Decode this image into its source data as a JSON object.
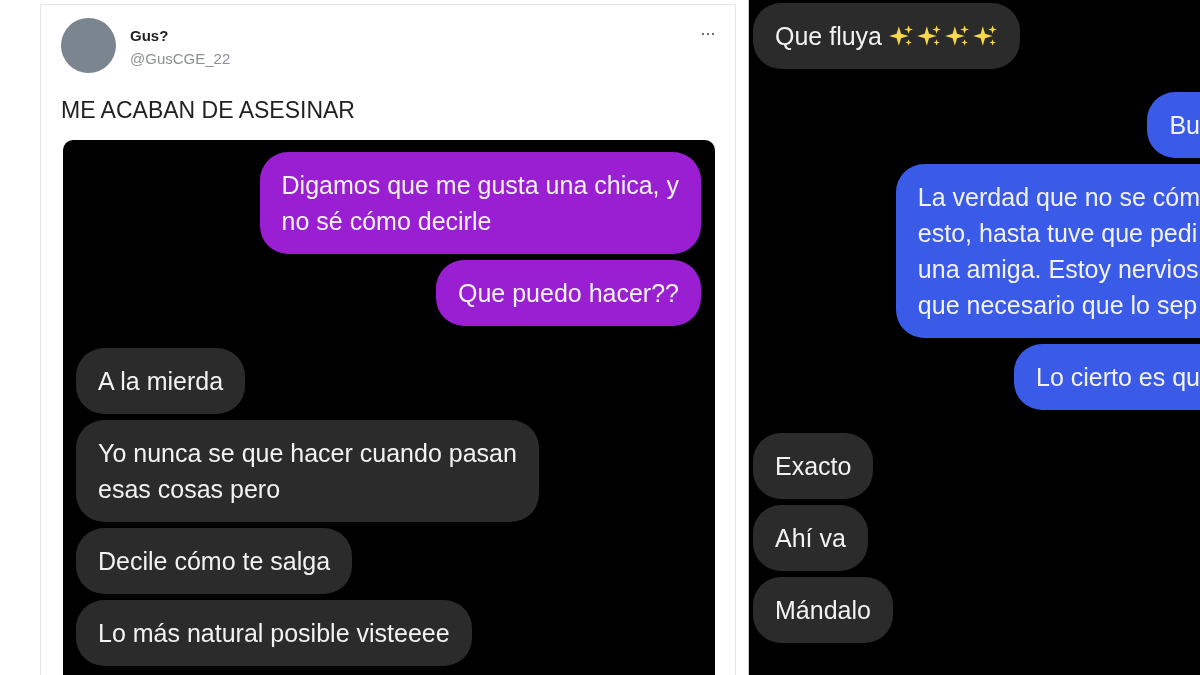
{
  "tweet": {
    "author_name": "Gus?",
    "author_handle": "@GusCGE_22",
    "more_menu": "···",
    "text": "ME ACABAN DE ASESINAR",
    "chat": [
      {
        "kind": "sent",
        "text": "Digamos que me gusta una chica, y\nno sé cómo decirle"
      },
      {
        "kind": "sent",
        "text": "Que puedo hacer??"
      },
      {
        "kind": "received",
        "text": "A la mierda"
      },
      {
        "kind": "received",
        "text": "Yo nunca se que hacer cuando pasan\nesas cosas pero"
      },
      {
        "kind": "received",
        "text": "Decile cómo te salga"
      },
      {
        "kind": "received",
        "text": "Lo más natural posible visteeee"
      }
    ]
  },
  "second_chat": [
    {
      "kind": "received",
      "text": "Que fluya",
      "sparkles": true
    },
    {
      "kind": "sent",
      "text": "Bu"
    },
    {
      "kind": "sent",
      "text": "La verdad que no se cóm\nesto, hasta tuve que pedi\nuna amiga. Estoy nervios\nque necesario que lo sep"
    },
    {
      "kind": "sent",
      "text": "Lo cierto es qu"
    },
    {
      "kind": "received",
      "text": "Exacto"
    },
    {
      "kind": "received",
      "text": "Ahí va"
    },
    {
      "kind": "received",
      "text": "Mándalo"
    }
  ]
}
